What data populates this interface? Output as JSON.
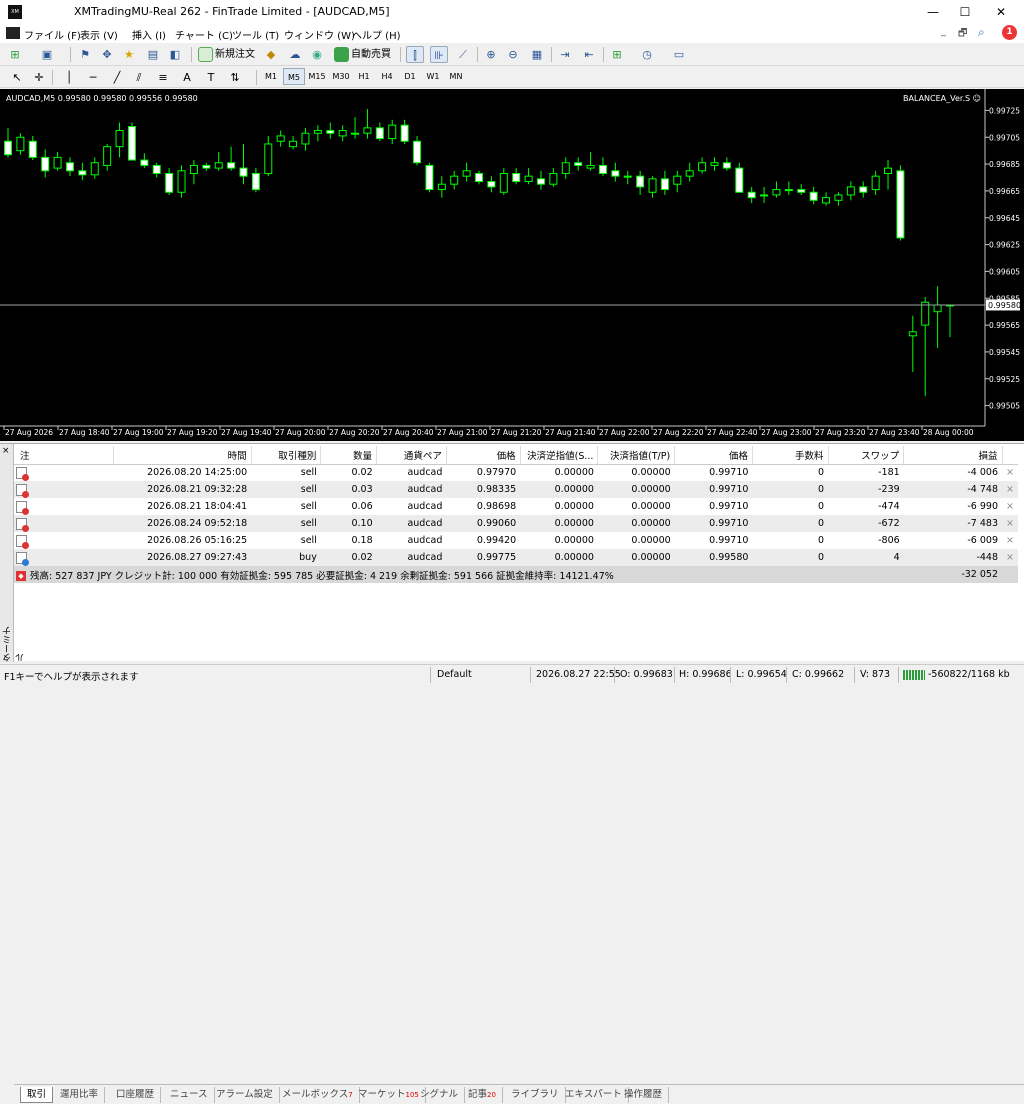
{
  "window": {
    "title": "XMTradingMU-Real 262 - FinTrade Limited - [AUDCAD,M5]",
    "icon_text": "XM",
    "minimize": "—",
    "maximize": "☐",
    "close": "✕"
  },
  "menu": [
    "ファイル (F)",
    "表示 (V)",
    "挿入 (I)",
    "チャート (C)",
    "ツール (T)",
    "ウィンドウ (W)",
    "ヘルプ (H)"
  ],
  "mdi_controls": [
    "_",
    "🗗",
    "✕"
  ],
  "notification_count": "1",
  "toolbar": {
    "new_order": "新規注文",
    "auto_trading": "自動売買",
    "timeframes": [
      "M1",
      "M5",
      "M15",
      "M30",
      "H1",
      "H4",
      "D1",
      "W1",
      "MN"
    ],
    "active_timeframe": "M5"
  },
  "chart": {
    "header": "AUDCAD,M5  0.99580 0.99580 0.99556 0.99580",
    "ea_label": "BALANCEA_Ver.S ☺",
    "current_price": "0.99580",
    "colors": {
      "background": "#000000",
      "candle": "#00ff00",
      "bull_fill": "#000000",
      "bear_fill": "#ffffff",
      "price_line": "#9aa0a6"
    }
  },
  "chart_data": {
    "type": "candlestick",
    "symbol": "AUDCAD",
    "timeframe": "M5",
    "ylim": [
      0.99495,
      0.99735
    ],
    "yticks": [
      "0.99725",
      "0.99705",
      "0.99685",
      "0.99665",
      "0.99645",
      "0.99625",
      "0.99605",
      "0.99585",
      "0.99565",
      "0.99545",
      "0.99525",
      "0.99505"
    ],
    "ytick_values": [
      0.99725,
      0.99705,
      0.99685,
      0.99665,
      0.99645,
      0.99625,
      0.99605,
      0.99585,
      0.99565,
      0.99545,
      0.99525,
      0.99505
    ],
    "xticks": [
      "27 Aug 2026",
      "27 Aug 18:40",
      "27 Aug 19:00",
      "27 Aug 19:20",
      "27 Aug 19:40",
      "27 Aug 20:00",
      "27 Aug 20:20",
      "27 Aug 20:40",
      "27 Aug 21:00",
      "27 Aug 21:20",
      "27 Aug 21:40",
      "27 Aug 22:00",
      "27 Aug 22:20",
      "27 Aug 22:40",
      "27 Aug 23:00",
      "27 Aug 23:20",
      "27 Aug 23:40",
      "28 Aug 00:00"
    ],
    "candles": [
      [
        0.99702,
        0.99712,
        0.9969,
        0.99692
      ],
      [
        0.99695,
        0.99708,
        0.99692,
        0.99705
      ],
      [
        0.99702,
        0.99706,
        0.99688,
        0.9969
      ],
      [
        0.9969,
        0.99696,
        0.99675,
        0.9968
      ],
      [
        0.99682,
        0.99694,
        0.9968,
        0.9969
      ],
      [
        0.99686,
        0.9969,
        0.99676,
        0.9968
      ],
      [
        0.9968,
        0.99686,
        0.99673,
        0.99677
      ],
      [
        0.99677,
        0.9969,
        0.99674,
        0.99686
      ],
      [
        0.99684,
        0.997,
        0.9968,
        0.99698
      ],
      [
        0.99698,
        0.99716,
        0.9969,
        0.9971
      ],
      [
        0.99713,
        0.99716,
        0.99688,
        0.99688
      ],
      [
        0.99688,
        0.99693,
        0.99682,
        0.99684
      ],
      [
        0.99684,
        0.99686,
        0.99675,
        0.99678
      ],
      [
        0.99678,
        0.99682,
        0.99662,
        0.99664
      ],
      [
        0.99664,
        0.99684,
        0.9966,
        0.9968
      ],
      [
        0.99678,
        0.99688,
        0.9967,
        0.99684
      ],
      [
        0.99684,
        0.99686,
        0.9968,
        0.99682
      ],
      [
        0.99682,
        0.99694,
        0.9968,
        0.99686
      ],
      [
        0.99686,
        0.99698,
        0.9968,
        0.99682
      ],
      [
        0.99682,
        0.997,
        0.9967,
        0.99676
      ],
      [
        0.99678,
        0.99682,
        0.99664,
        0.99666
      ],
      [
        0.99678,
        0.99706,
        0.99676,
        0.997
      ],
      [
        0.99702,
        0.9971,
        0.99698,
        0.99706
      ],
      [
        0.99698,
        0.99706,
        0.99696,
        0.99702
      ],
      [
        0.997,
        0.99712,
        0.99695,
        0.99708
      ],
      [
        0.99708,
        0.99714,
        0.99702,
        0.9971
      ],
      [
        0.9971,
        0.99716,
        0.99704,
        0.99708
      ],
      [
        0.99706,
        0.99714,
        0.99702,
        0.9971
      ],
      [
        0.99708,
        0.9972,
        0.99704,
        0.99708
      ],
      [
        0.99708,
        0.99726,
        0.99704,
        0.99712
      ],
      [
        0.99712,
        0.99716,
        0.99702,
        0.99704
      ],
      [
        0.99704,
        0.99718,
        0.997,
        0.99714
      ],
      [
        0.99714,
        0.99718,
        0.997,
        0.99702
      ],
      [
        0.99702,
        0.99706,
        0.99684,
        0.99686
      ],
      [
        0.99684,
        0.99686,
        0.99664,
        0.99666
      ],
      [
        0.99666,
        0.99676,
        0.9966,
        0.9967
      ],
      [
        0.9967,
        0.9968,
        0.99666,
        0.99676
      ],
      [
        0.99676,
        0.99686,
        0.99672,
        0.9968
      ],
      [
        0.99678,
        0.9968,
        0.9967,
        0.99672
      ],
      [
        0.99672,
        0.99676,
        0.99664,
        0.99668
      ],
      [
        0.99664,
        0.99682,
        0.99662,
        0.99678
      ],
      [
        0.99678,
        0.99682,
        0.9967,
        0.99672
      ],
      [
        0.99672,
        0.99682,
        0.9967,
        0.99676
      ],
      [
        0.99674,
        0.9968,
        0.99666,
        0.9967
      ],
      [
        0.9967,
        0.99682,
        0.99668,
        0.99678
      ],
      [
        0.99678,
        0.9969,
        0.99674,
        0.99686
      ],
      [
        0.99686,
        0.9969,
        0.9968,
        0.99684
      ],
      [
        0.99682,
        0.99694,
        0.9968,
        0.99684
      ],
      [
        0.99684,
        0.9969,
        0.99676,
        0.99678
      ],
      [
        0.9968,
        0.99686,
        0.99672,
        0.99676
      ],
      [
        0.99676,
        0.9968,
        0.9967,
        0.99676
      ],
      [
        0.99676,
        0.9968,
        0.99662,
        0.99668
      ],
      [
        0.99664,
        0.99676,
        0.9966,
        0.99674
      ],
      [
        0.99674,
        0.9968,
        0.99662,
        0.99666
      ],
      [
        0.9967,
        0.9968,
        0.99664,
        0.99676
      ],
      [
        0.99676,
        0.99686,
        0.99672,
        0.9968
      ],
      [
        0.9968,
        0.9969,
        0.99678,
        0.99686
      ],
      [
        0.99684,
        0.9969,
        0.9968,
        0.99686
      ],
      [
        0.99686,
        0.9969,
        0.9968,
        0.99682
      ],
      [
        0.99682,
        0.99686,
        0.99664,
        0.99664
      ],
      [
        0.99664,
        0.99668,
        0.99656,
        0.9966
      ],
      [
        0.99662,
        0.99668,
        0.99656,
        0.99662
      ],
      [
        0.99662,
        0.99672,
        0.9966,
        0.99666
      ],
      [
        0.99666,
        0.99672,
        0.99662,
        0.99666
      ],
      [
        0.99666,
        0.9967,
        0.99662,
        0.99664
      ],
      [
        0.99664,
        0.99668,
        0.99655,
        0.99658
      ],
      [
        0.99656,
        0.99664,
        0.99654,
        0.9966
      ],
      [
        0.99658,
        0.99664,
        0.99654,
        0.99662
      ],
      [
        0.99662,
        0.99672,
        0.99658,
        0.99668
      ],
      [
        0.99668,
        0.99672,
        0.9966,
        0.99664
      ],
      [
        0.99666,
        0.9968,
        0.99662,
        0.99676
      ],
      [
        0.99678,
        0.99688,
        0.99666,
        0.99682
      ],
      [
        0.9968,
        0.99684,
        0.99628,
        0.9963
      ],
      [
        0.99557,
        0.99572,
        0.9953,
        0.9956
      ],
      [
        0.99565,
        0.99586,
        0.99512,
        0.99582
      ],
      [
        0.99575,
        0.99594,
        0.99548,
        0.9958
      ],
      [
        0.9958,
        0.9958,
        0.99556,
        0.9958
      ]
    ]
  },
  "terminal": {
    "label": "ターミナル",
    "close": "×",
    "columns": [
      "注",
      "時間",
      "取引種別",
      "数量",
      "通貨ペア",
      "価格",
      "決済逆指値(S...",
      "決済指値(T/P)",
      "価格",
      "手数料",
      "スワップ",
      "損益"
    ],
    "orders": [
      {
        "type": "sell",
        "time": "2026.08.20 14:25:00",
        "volume": "0.02",
        "symbol": "audcad",
        "price": "0.97970",
        "sl": "0.00000",
        "tp": "0.00000",
        "cur": "0.99710",
        "commission": "0",
        "swap": "-181",
        "profit": "-4 006",
        "icon": "#d33"
      },
      {
        "type": "sell",
        "time": "2026.08.21 09:32:28",
        "volume": "0.03",
        "symbol": "audcad",
        "price": "0.98335",
        "sl": "0.00000",
        "tp": "0.00000",
        "cur": "0.99710",
        "commission": "0",
        "swap": "-239",
        "profit": "-4 748",
        "icon": "#d33"
      },
      {
        "type": "sell",
        "time": "2026.08.21 18:04:41",
        "volume": "0.06",
        "symbol": "audcad",
        "price": "0.98698",
        "sl": "0.00000",
        "tp": "0.00000",
        "cur": "0.99710",
        "commission": "0",
        "swap": "-474",
        "profit": "-6 990",
        "icon": "#d33"
      },
      {
        "type": "sell",
        "time": "2026.08.24 09:52:18",
        "volume": "0.10",
        "symbol": "audcad",
        "price": "0.99060",
        "sl": "0.00000",
        "tp": "0.00000",
        "cur": "0.99710",
        "commission": "0",
        "swap": "-672",
        "profit": "-7 483",
        "icon": "#d33"
      },
      {
        "type": "sell",
        "time": "2026.08.26 05:16:25",
        "volume": "0.18",
        "symbol": "audcad",
        "price": "0.99420",
        "sl": "0.00000",
        "tp": "0.00000",
        "cur": "0.99710",
        "commission": "0",
        "swap": "-806",
        "profit": "-6 009",
        "icon": "#d33"
      },
      {
        "type": "buy",
        "time": "2026.08.27 09:27:43",
        "volume": "0.02",
        "symbol": "audcad",
        "price": "0.99775",
        "sl": "0.00000",
        "tp": "0.00000",
        "cur": "0.99580",
        "commission": "0",
        "swap": "4",
        "profit": "-448",
        "icon": "#2a7bd3"
      }
    ],
    "summary": "残高: 527 837 JPY  クレジット計: 100 000  有効証拠金: 595 785  必要証拠金: 4 219  余剰証拠金: 591 566  証拠金維持率: 14121.47%",
    "summary_total": "-32 052",
    "tabs": [
      {
        "label": "取引",
        "badge": ""
      },
      {
        "label": "運用比率",
        "badge": ""
      },
      {
        "label": "口座履歴",
        "badge": ""
      },
      {
        "label": "ニュース",
        "badge": ""
      },
      {
        "label": "アラーム設定",
        "badge": ""
      },
      {
        "label": "メールボックス",
        "badge": "7"
      },
      {
        "label": "マーケット",
        "badge": "105"
      },
      {
        "label": "シグナル",
        "badge": ""
      },
      {
        "label": "記事",
        "badge": "20"
      },
      {
        "label": "ライブラリ",
        "badge": ""
      },
      {
        "label": "エキスパート",
        "badge": ""
      },
      {
        "label": "操作履歴",
        "badge": ""
      }
    ]
  },
  "status": {
    "help": "F1キーでヘルプが表示されます",
    "profile": "Default",
    "datetime": "2026.08.27 22:55",
    "open": "O: 0.99683",
    "high": "H: 0.99686",
    "low": "L: 0.99654",
    "close": "C: 0.99662",
    "volume": "V: 873",
    "traffic": "-560822/1168 kb"
  }
}
